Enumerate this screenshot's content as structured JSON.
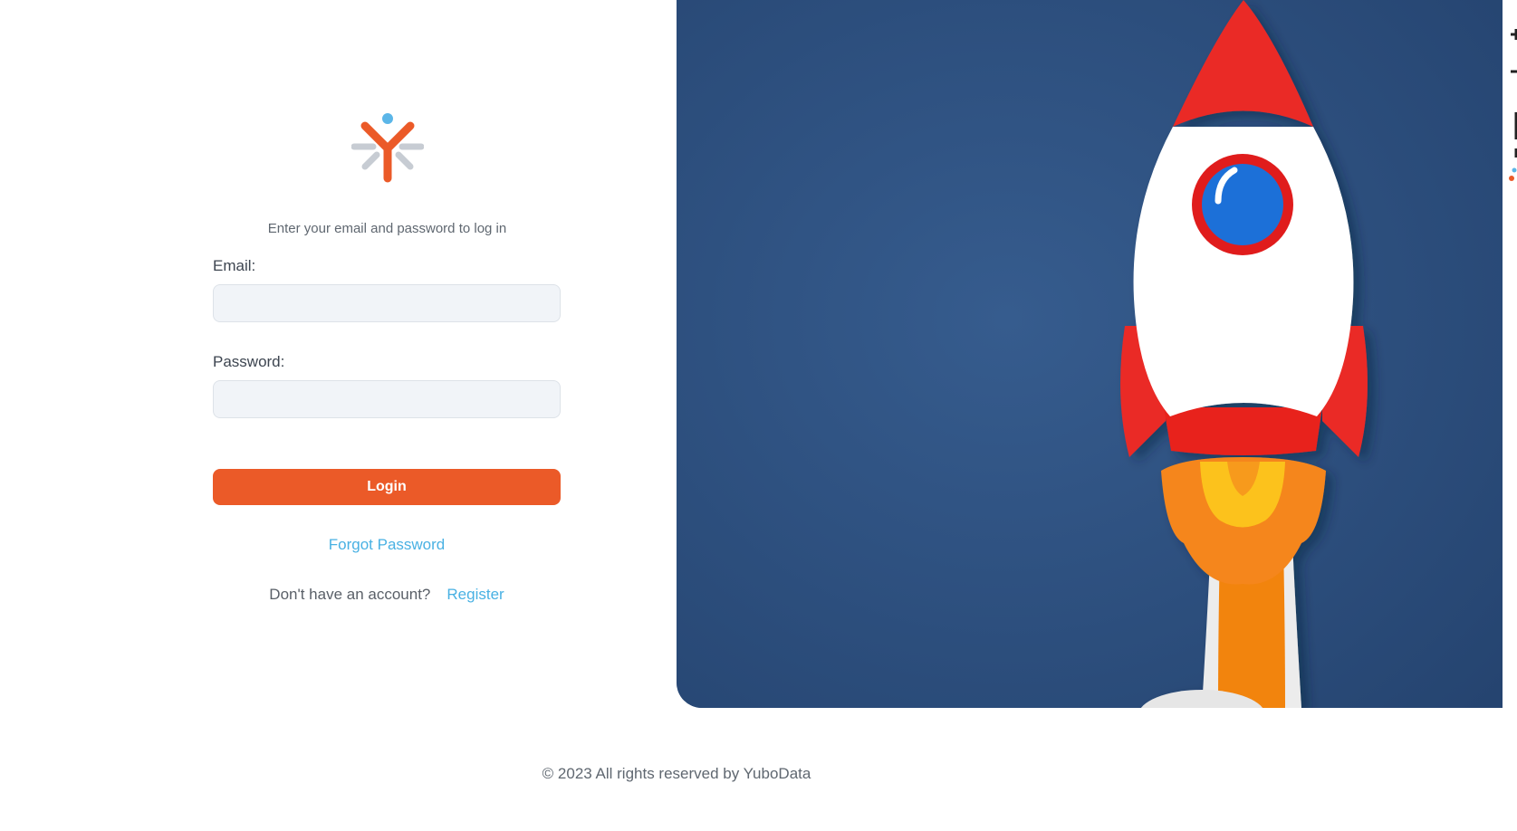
{
  "login": {
    "subtitle": "Enter your email and password to log in",
    "email_label": "Email:",
    "email_value": "",
    "password_label": "Password:",
    "password_value": "",
    "login_button": "Login",
    "forgot_password": "Forgot Password",
    "no_account_text": "Don't have an account?",
    "register_link": "Register"
  },
  "footer": {
    "copyright": "© 2023 All rights reserved by YuboData"
  },
  "icons": {
    "logo": "yubodata-logo-icon",
    "hero": "rocket-illustration"
  },
  "colors": {
    "accent": "#eb5a28",
    "link": "#49b1e3",
    "hero_background": "#2f5182",
    "input_background": "#f1f4f8"
  }
}
